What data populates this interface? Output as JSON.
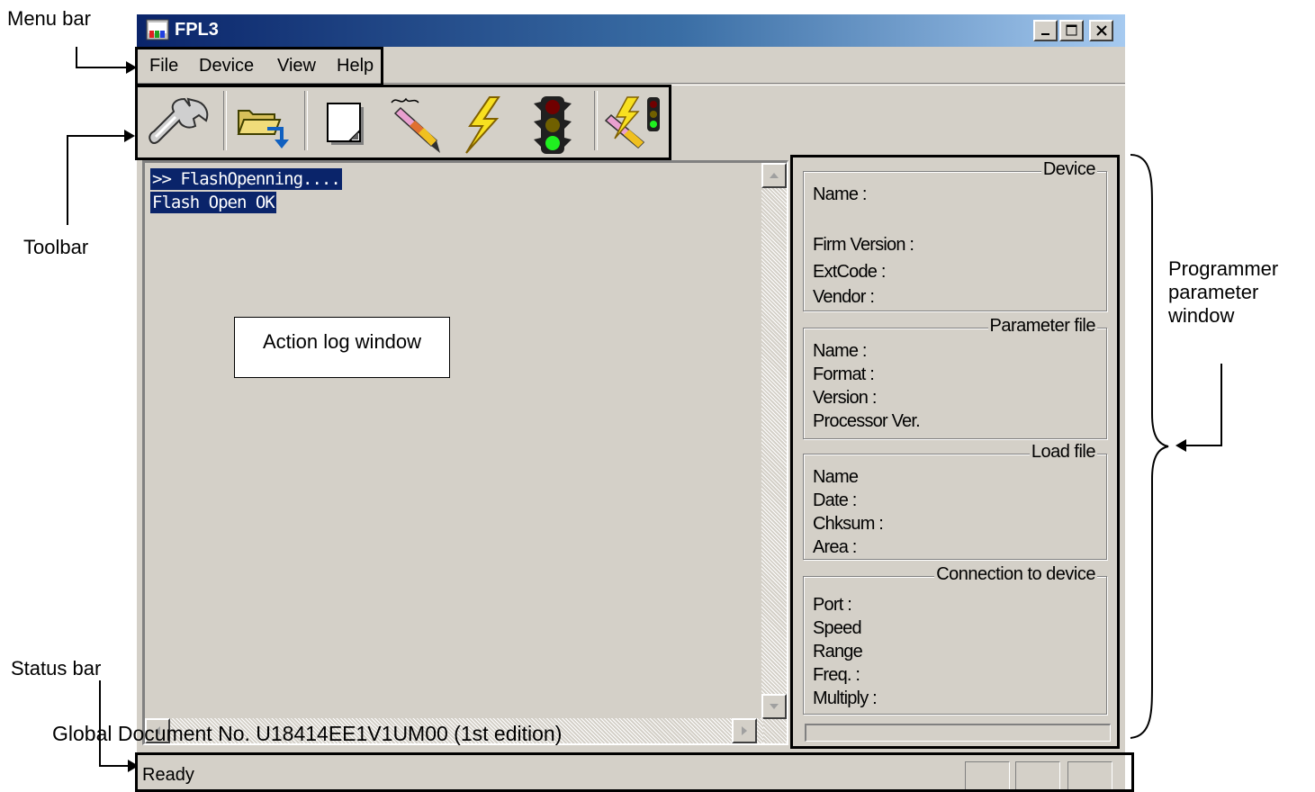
{
  "annotations": {
    "menu_bar": "Menu bar",
    "toolbar": "Toolbar",
    "status_bar": "Status bar",
    "programmer_parameter_window": [
      "Programmer",
      "parameter",
      "window"
    ],
    "action_log_window": "Action log window",
    "document_footer": "Global Document No. U18414EE1V1UM00 (1st edition)"
  },
  "window": {
    "title": "FPL3",
    "title_color": "#0a246a"
  },
  "menu": {
    "items": [
      "File",
      "Device",
      "View",
      "Help"
    ]
  },
  "toolbar": {
    "buttons": [
      {
        "name": "setup-wrench",
        "icon": "wrench-icon"
      },
      {
        "name": "load-file",
        "icon": "folder-arrow-icon"
      },
      {
        "name": "blank",
        "icon": "blank-page-icon"
      },
      {
        "name": "erase",
        "icon": "eraser-pen-icon"
      },
      {
        "name": "program",
        "icon": "lightning-icon"
      },
      {
        "name": "verify",
        "icon": "traffic-light-icon"
      },
      {
        "name": "autoprocedure",
        "icon": "combined-autoprocedure-icon"
      }
    ]
  },
  "log": {
    "lines": [
      ">> FlashOpenning....",
      "Flash Open OK"
    ]
  },
  "parameters": {
    "device": {
      "title": "Device",
      "fields": [
        "Name :",
        "Firm Version :",
        "ExtCode :",
        "Vendor :"
      ]
    },
    "parameter_file": {
      "title": "Parameter file",
      "fields": [
        "Name :",
        "Format :",
        "Version :",
        "Processor Ver."
      ]
    },
    "load_file": {
      "title": "Load file",
      "fields": [
        "Name",
        "Date :",
        "Chksum :",
        "Area :"
      ]
    },
    "connection": {
      "title": "Connection to device",
      "fields": [
        "Port :",
        "Speed",
        "Range",
        "Freq. :",
        "Multiply :"
      ]
    }
  },
  "status": {
    "text": "Ready"
  }
}
